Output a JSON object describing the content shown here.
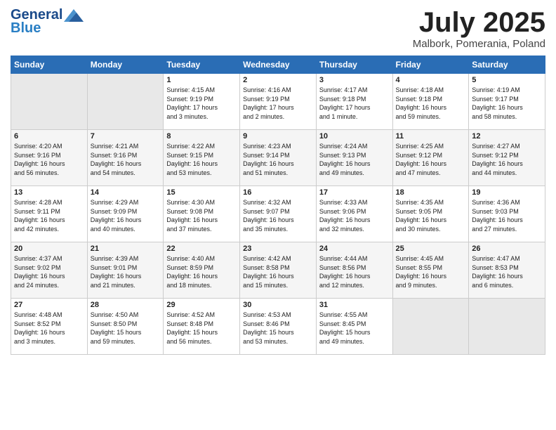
{
  "header": {
    "logo_line1": "General",
    "logo_line2": "Blue",
    "month": "July 2025",
    "location": "Malbork, Pomerania, Poland"
  },
  "days_of_week": [
    "Sunday",
    "Monday",
    "Tuesday",
    "Wednesday",
    "Thursday",
    "Friday",
    "Saturday"
  ],
  "weeks": [
    [
      {
        "day": "",
        "info": ""
      },
      {
        "day": "",
        "info": ""
      },
      {
        "day": "1",
        "info": "Sunrise: 4:15 AM\nSunset: 9:19 PM\nDaylight: 17 hours\nand 3 minutes."
      },
      {
        "day": "2",
        "info": "Sunrise: 4:16 AM\nSunset: 9:19 PM\nDaylight: 17 hours\nand 2 minutes."
      },
      {
        "day": "3",
        "info": "Sunrise: 4:17 AM\nSunset: 9:18 PM\nDaylight: 17 hours\nand 1 minute."
      },
      {
        "day": "4",
        "info": "Sunrise: 4:18 AM\nSunset: 9:18 PM\nDaylight: 16 hours\nand 59 minutes."
      },
      {
        "day": "5",
        "info": "Sunrise: 4:19 AM\nSunset: 9:17 PM\nDaylight: 16 hours\nand 58 minutes."
      }
    ],
    [
      {
        "day": "6",
        "info": "Sunrise: 4:20 AM\nSunset: 9:16 PM\nDaylight: 16 hours\nand 56 minutes."
      },
      {
        "day": "7",
        "info": "Sunrise: 4:21 AM\nSunset: 9:16 PM\nDaylight: 16 hours\nand 54 minutes."
      },
      {
        "day": "8",
        "info": "Sunrise: 4:22 AM\nSunset: 9:15 PM\nDaylight: 16 hours\nand 53 minutes."
      },
      {
        "day": "9",
        "info": "Sunrise: 4:23 AM\nSunset: 9:14 PM\nDaylight: 16 hours\nand 51 minutes."
      },
      {
        "day": "10",
        "info": "Sunrise: 4:24 AM\nSunset: 9:13 PM\nDaylight: 16 hours\nand 49 minutes."
      },
      {
        "day": "11",
        "info": "Sunrise: 4:25 AM\nSunset: 9:12 PM\nDaylight: 16 hours\nand 47 minutes."
      },
      {
        "day": "12",
        "info": "Sunrise: 4:27 AM\nSunset: 9:12 PM\nDaylight: 16 hours\nand 44 minutes."
      }
    ],
    [
      {
        "day": "13",
        "info": "Sunrise: 4:28 AM\nSunset: 9:11 PM\nDaylight: 16 hours\nand 42 minutes."
      },
      {
        "day": "14",
        "info": "Sunrise: 4:29 AM\nSunset: 9:09 PM\nDaylight: 16 hours\nand 40 minutes."
      },
      {
        "day": "15",
        "info": "Sunrise: 4:30 AM\nSunset: 9:08 PM\nDaylight: 16 hours\nand 37 minutes."
      },
      {
        "day": "16",
        "info": "Sunrise: 4:32 AM\nSunset: 9:07 PM\nDaylight: 16 hours\nand 35 minutes."
      },
      {
        "day": "17",
        "info": "Sunrise: 4:33 AM\nSunset: 9:06 PM\nDaylight: 16 hours\nand 32 minutes."
      },
      {
        "day": "18",
        "info": "Sunrise: 4:35 AM\nSunset: 9:05 PM\nDaylight: 16 hours\nand 30 minutes."
      },
      {
        "day": "19",
        "info": "Sunrise: 4:36 AM\nSunset: 9:03 PM\nDaylight: 16 hours\nand 27 minutes."
      }
    ],
    [
      {
        "day": "20",
        "info": "Sunrise: 4:37 AM\nSunset: 9:02 PM\nDaylight: 16 hours\nand 24 minutes."
      },
      {
        "day": "21",
        "info": "Sunrise: 4:39 AM\nSunset: 9:01 PM\nDaylight: 16 hours\nand 21 minutes."
      },
      {
        "day": "22",
        "info": "Sunrise: 4:40 AM\nSunset: 8:59 PM\nDaylight: 16 hours\nand 18 minutes."
      },
      {
        "day": "23",
        "info": "Sunrise: 4:42 AM\nSunset: 8:58 PM\nDaylight: 16 hours\nand 15 minutes."
      },
      {
        "day": "24",
        "info": "Sunrise: 4:44 AM\nSunset: 8:56 PM\nDaylight: 16 hours\nand 12 minutes."
      },
      {
        "day": "25",
        "info": "Sunrise: 4:45 AM\nSunset: 8:55 PM\nDaylight: 16 hours\nand 9 minutes."
      },
      {
        "day": "26",
        "info": "Sunrise: 4:47 AM\nSunset: 8:53 PM\nDaylight: 16 hours\nand 6 minutes."
      }
    ],
    [
      {
        "day": "27",
        "info": "Sunrise: 4:48 AM\nSunset: 8:52 PM\nDaylight: 16 hours\nand 3 minutes."
      },
      {
        "day": "28",
        "info": "Sunrise: 4:50 AM\nSunset: 8:50 PM\nDaylight: 15 hours\nand 59 minutes."
      },
      {
        "day": "29",
        "info": "Sunrise: 4:52 AM\nSunset: 8:48 PM\nDaylight: 15 hours\nand 56 minutes."
      },
      {
        "day": "30",
        "info": "Sunrise: 4:53 AM\nSunset: 8:46 PM\nDaylight: 15 hours\nand 53 minutes."
      },
      {
        "day": "31",
        "info": "Sunrise: 4:55 AM\nSunset: 8:45 PM\nDaylight: 15 hours\nand 49 minutes."
      },
      {
        "day": "",
        "info": ""
      },
      {
        "day": "",
        "info": ""
      }
    ]
  ]
}
